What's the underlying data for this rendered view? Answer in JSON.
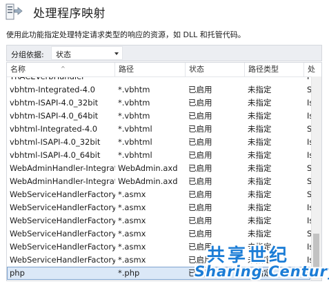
{
  "header": {
    "title": "处理程序映射",
    "icon": "handler-mappings-icon"
  },
  "description": "使用此功能指定处理特定请求类型的响应的资源，如 DLL 和托管代码。",
  "toolbar": {
    "group_by_label": "分组依据:",
    "group_by_value": "状态"
  },
  "table": {
    "columns": [
      "名称",
      "路径",
      "状态",
      "路径类型",
      "处"
    ],
    "rows": [
      [
        "TRACEVerbHandler",
        "",
        "",
        "",
        "Pr"
      ],
      [
        "vbhtm-Integrated-4.0",
        "*.vbhtm",
        "已启用",
        "未指定",
        "Sy"
      ],
      [
        "vbhtm-ISAPI-4.0_32bit",
        "*.vbhtm",
        "已启用",
        "未指定",
        "Isa"
      ],
      [
        "vbhtm-ISAPI-4.0_64bit",
        "*.vbhtm",
        "已启用",
        "未指定",
        "Isa"
      ],
      [
        "vbhtml-Integrated-4.0",
        "*.vbhtml",
        "已启用",
        "未指定",
        "Sy"
      ],
      [
        "vbhtml-ISAPI-4.0_32bit",
        "*.vbhtml",
        "已启用",
        "未指定",
        "Isa"
      ],
      [
        "vbhtml-ISAPI-4.0_64bit",
        "*.vbhtml",
        "已启用",
        "未指定",
        "Isa"
      ],
      [
        "WebAdminHandler-Integrat...",
        "WebAdmin.axd",
        "已启用",
        "未指定",
        "Sy"
      ],
      [
        "WebAdminHandler-Integrat...",
        "WebAdmin.axd",
        "已启用",
        "未指定",
        "Sy"
      ],
      [
        "WebServiceHandlerFactory-...",
        "*.asmx",
        "已启用",
        "未指定",
        "Sy"
      ],
      [
        "WebServiceHandlerFactory-...",
        "*.asmx",
        "已启用",
        "未指定",
        "Isa"
      ],
      [
        "WebServiceHandlerFactory-...",
        "*.asmx",
        "已启用",
        "未指定",
        "Isa"
      ],
      [
        "WebServiceHandlerFactory-...",
        "*.asmx",
        "已启用",
        "未指定",
        "Sy"
      ],
      [
        "WebServiceHandlerFactory-...",
        "*.asmx",
        "已启用",
        "未指定",
        "Isa"
      ],
      [
        "WebServiceHandlerFactory-...",
        "*.asmx",
        "已启用",
        "未指定",
        "Isa"
      ],
      [
        "php",
        "*.php",
        "已启用",
        "未指定",
        ""
      ]
    ],
    "selected_row": 15
  },
  "watermark": {
    "chinese": "共享世纪",
    "english": "Sharing Century"
  },
  "colors": {
    "selection": "#dbe8f7",
    "watermark": "#1c7dd6",
    "toolbar_bg": "#eceef2"
  }
}
